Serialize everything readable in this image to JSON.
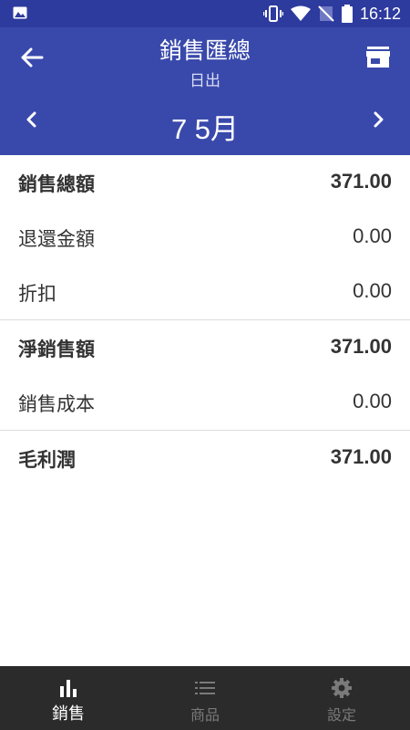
{
  "status_bar": {
    "time": "16:12"
  },
  "header": {
    "title": "銷售匯總",
    "subtitle": "日出",
    "month": "7 5月"
  },
  "summary": {
    "rows": [
      {
        "label": "銷售總額",
        "value": "371.00"
      },
      {
        "label": "退還金額",
        "value": "0.00"
      },
      {
        "label": "折扣",
        "value": "0.00"
      },
      {
        "label": "淨銷售額",
        "value": "371.00"
      },
      {
        "label": "銷售成本",
        "value": "0.00"
      },
      {
        "label": "毛利潤",
        "value": "371.00"
      }
    ]
  },
  "bottom_nav": {
    "items": [
      {
        "label": "銷售"
      },
      {
        "label": "商品"
      },
      {
        "label": "設定"
      }
    ]
  },
  "colors": {
    "status_bar": "#2d3a9e",
    "app_bar": "#3949ab",
    "bottom_nav": "#2b2b2b"
  }
}
